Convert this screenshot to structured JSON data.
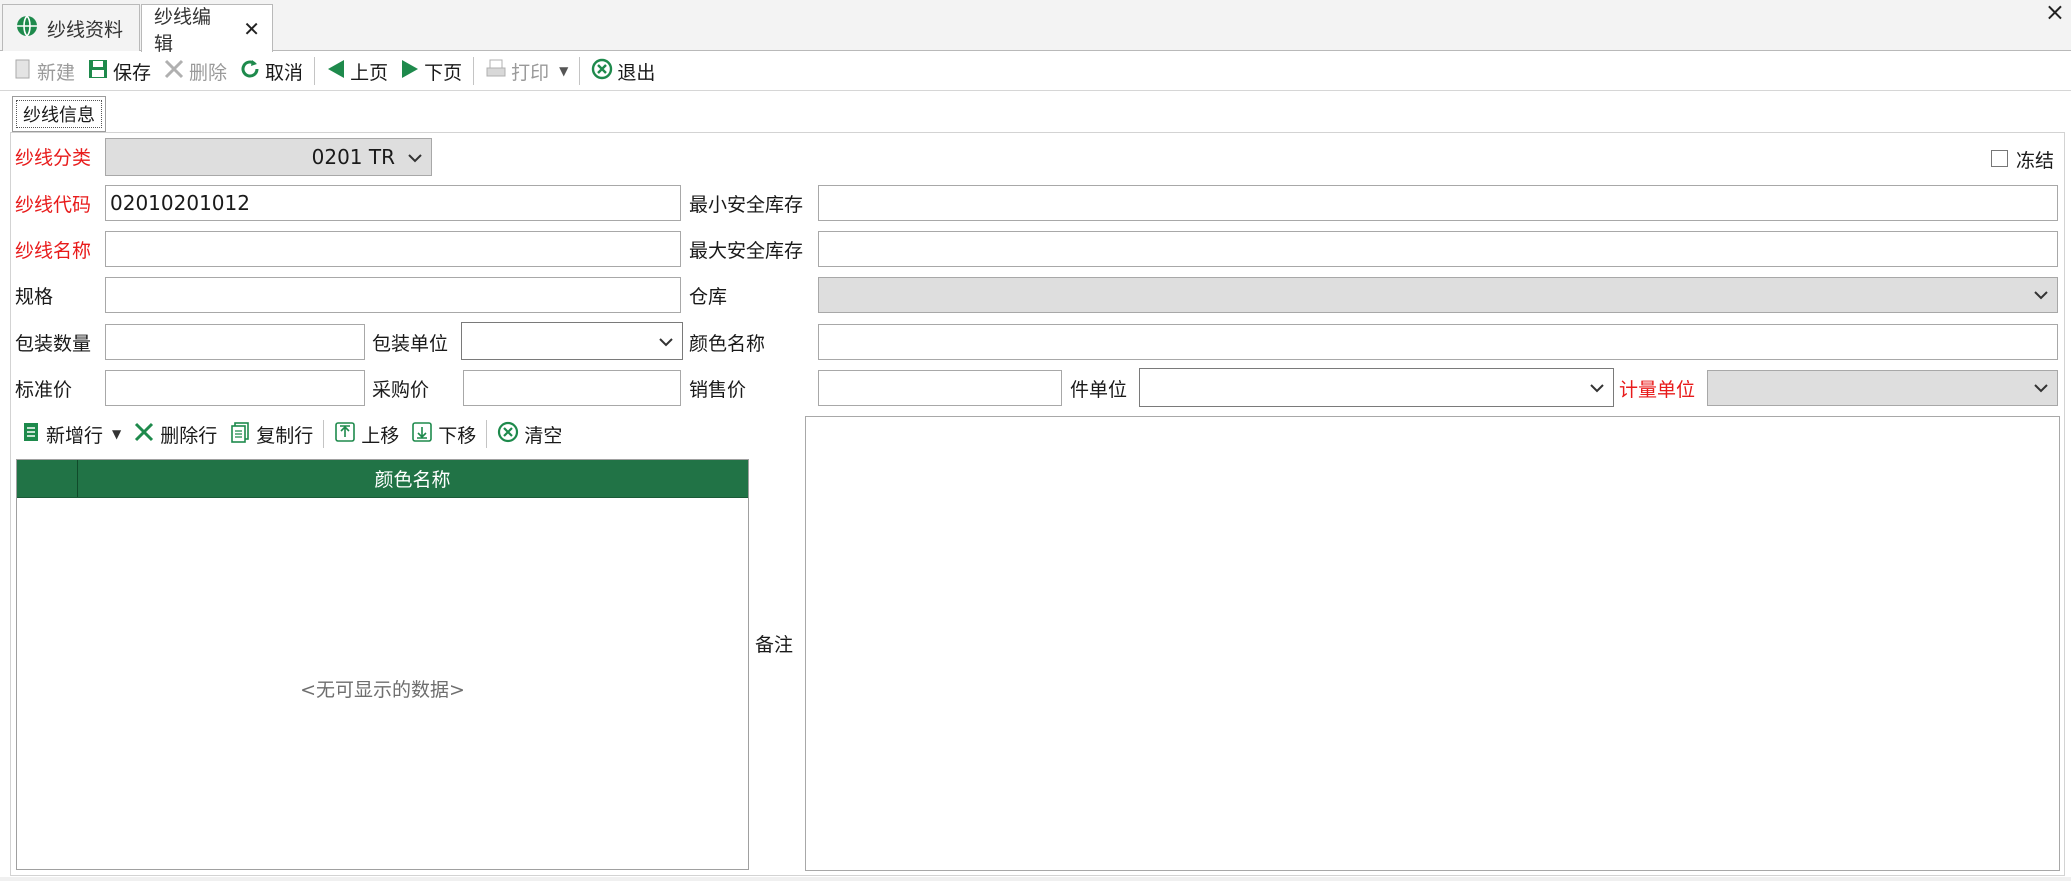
{
  "tabs": [
    {
      "label": "纱线资料",
      "icon": "globe-icon",
      "active": false
    },
    {
      "label": "纱线编辑",
      "icon": "",
      "active": true,
      "closable": true
    }
  ],
  "window_close": "×",
  "toolbar": {
    "new": "新建",
    "save": "保存",
    "delete": "删除",
    "cancel": "取消",
    "prev": "上页",
    "next": "下页",
    "print": "打印",
    "exit": "退出"
  },
  "page_tab": "纱线信息",
  "form": {
    "category_label": "纱线分类",
    "category_value": "0201 TR",
    "frozen_label": "冻结",
    "code_label": "纱线代码",
    "code_value": "02010201012",
    "name_label": "纱线名称",
    "name_value": "",
    "spec_label": "规格",
    "pack_qty_label": "包装数量",
    "pack_unit_label": "包装单位",
    "std_price_label": "标准价",
    "purchase_price_label": "采购价",
    "min_stock_label": "最小安全库存",
    "max_stock_label": "最大安全库存",
    "warehouse_label": "仓库",
    "color_name_label": "颜色名称",
    "sale_price_label": "销售价",
    "piece_unit_label": "件单位",
    "measure_unit_label": "计量单位",
    "remark_label": "备注"
  },
  "grid_toolbar": {
    "add_row": "新增行",
    "delete_row": "删除行",
    "copy_row": "复制行",
    "move_up": "上移",
    "move_down": "下移",
    "clear": "清空"
  },
  "grid": {
    "columns": [
      "颜色名称"
    ],
    "empty_text": "<无可显示的数据>"
  },
  "colors": {
    "required_label": "#e81b1b",
    "grid_header": "#217346",
    "accent_green": "#1e8a4c"
  }
}
